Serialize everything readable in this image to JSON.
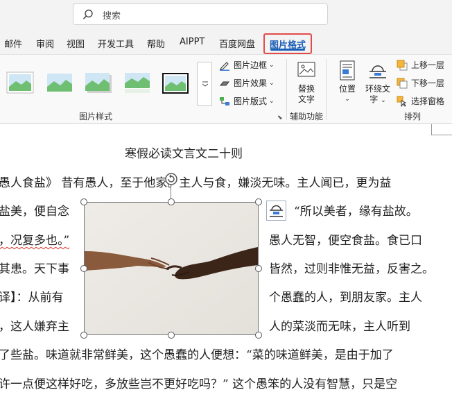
{
  "search": {
    "placeholder": "搜索"
  },
  "tabs": [
    {
      "label": "邮件"
    },
    {
      "label": "审阅"
    },
    {
      "label": "视图"
    },
    {
      "label": "开发工具"
    },
    {
      "label": "帮助"
    },
    {
      "label": "AIPPT"
    },
    {
      "label": "百度网盘"
    },
    {
      "label": "图片格式"
    }
  ],
  "ribbon": {
    "picture_styles": {
      "border": "图片边框",
      "effects": "图片效果",
      "layout": "图片版式",
      "group_label": "图片样式"
    },
    "accessibility": {
      "alt_text": [
        "替换",
        "文字"
      ],
      "group_label": "辅助功能"
    },
    "arrange": {
      "position": "位置",
      "wrap_text": [
        "环绕文",
        "字"
      ],
      "bring_forward": "上移一层",
      "send_backward": "下移一层",
      "selection_pane": "选择窗格",
      "group_label": "排列"
    }
  },
  "document": {
    "title": "寒假必读文言文二十则",
    "lines": [
      "愚人食盐》  昔有愚人，至于他家。主人与食，嫌淡无味。主人闻已，更为益",
      "盐美，便自念",
      "“所以美者，缘有盐故。",
      "，况复多也。”",
      "愚人无智，便空食盐。食已口",
      "其患。天下事",
      "皆然，过则非惟无益，反害之。",
      "译】：从前有",
      "个愚蠢的人，到朋友家。主人",
      "，这人嫌弃主",
      "人的菜淡而无味，主人听到",
      "了些盐。味道就非常鲜美，这个愚蠢的人便想：“菜的味道鲜美，是由于加了",
      "许一点便这样好吃，多放些岂不更好吃吗？” 这个愚笨的人没有智慧，只是空"
    ]
  }
}
